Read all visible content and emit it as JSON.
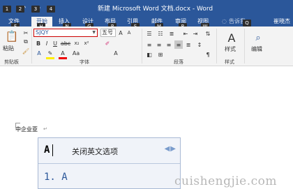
{
  "window": {
    "title": "新建 Microsoft Word 文档.docx - Word",
    "user_name": "崔晓杰"
  },
  "quick_access": {
    "items": [
      {
        "icon": "save-icon",
        "keytip": "1"
      },
      {
        "icon": "undo-icon",
        "keytip": "2"
      },
      {
        "icon": "redo-icon",
        "keytip": "3"
      },
      {
        "icon": "customize-icon",
        "keytip": "4"
      }
    ]
  },
  "tabs": [
    {
      "label": "文件",
      "keytip": "F"
    },
    {
      "label": "开始",
      "keytip": "H",
      "active": true
    },
    {
      "label": "插入",
      "keytip": "N"
    },
    {
      "label": "设计",
      "keytip": "G"
    },
    {
      "label": "布局",
      "keytip": "P"
    },
    {
      "label": "引用",
      "keytip": "S"
    },
    {
      "label": "邮件",
      "keytip": "M"
    },
    {
      "label": "审阅",
      "keytip": "R"
    },
    {
      "label": "视图",
      "keytip": "W"
    }
  ],
  "tell_me": {
    "label": "告诉我",
    "keytip": "Q"
  },
  "ribbon": {
    "font_name": "SJQY",
    "font_size": "五号",
    "groups": {
      "clipboard": "剪贴板",
      "font": "字体",
      "paragraph": "段落",
      "styles": "样式",
      "editing": "编辑"
    },
    "paste_label": "粘贴",
    "styles_label": "样式",
    "editing_label": "编辑"
  },
  "document": {
    "text": "中企业亚"
  },
  "ime": {
    "input_code": "A",
    "option_label": "关闭英文选项",
    "candidate": "1. A"
  },
  "watermark": "cuishengjie.com"
}
